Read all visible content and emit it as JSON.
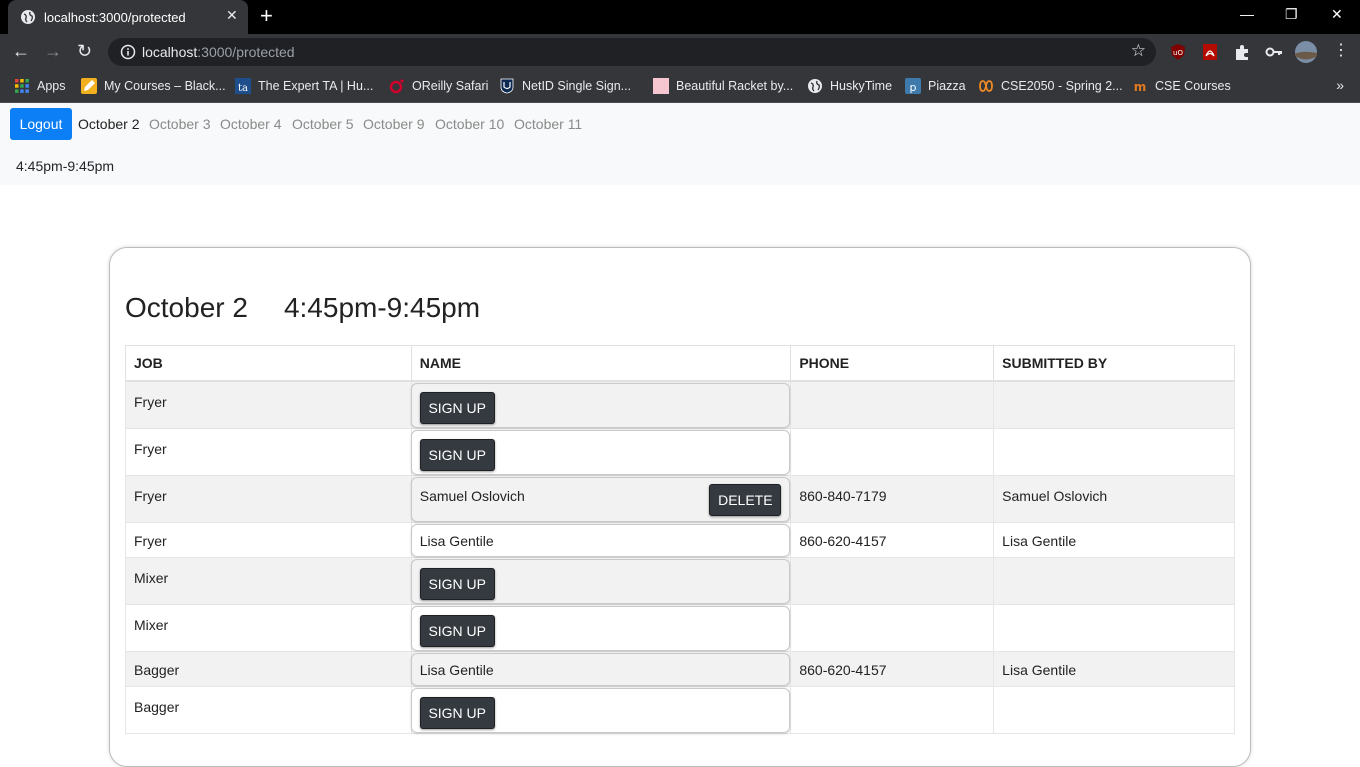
{
  "browser": {
    "tab_title": "localhost:3000/protected",
    "tab_close": "✕",
    "new_tab": "+",
    "url_host": "localhost",
    "url_path": ":3000/protected",
    "bookmarks": [
      {
        "label": "Apps",
        "icon": "apps-grid-icon"
      },
      {
        "label": "My Courses – Black...",
        "icon": "pencil-icon"
      },
      {
        "label": "The Expert TA | Hu...",
        "icon": "expert-ta-icon"
      },
      {
        "label": "OReilly Safari",
        "icon": "oreilly-icon"
      },
      {
        "label": "NetID Single Sign...",
        "icon": "uconn-shield-icon"
      },
      {
        "label": "Beautiful Racket by...",
        "icon": "racket-icon"
      },
      {
        "label": "HuskyTime",
        "icon": "globe-icon"
      },
      {
        "label": "Piazza",
        "icon": "piazza-icon"
      },
      {
        "label": "CSE2050 - Spring 2...",
        "icon": "infinity-icon"
      },
      {
        "label": "CSE Courses",
        "icon": "mooc-icon"
      }
    ],
    "bookmarks_more": "»"
  },
  "navbar": {
    "logout_label": "Logout",
    "dates": [
      "October 2",
      "October 3",
      "October 4",
      "October 5",
      "October 9",
      "October 10",
      "October 11"
    ],
    "active_date": "October 2",
    "shift_time": "4:45pm-9:45pm"
  },
  "card": {
    "date": "October 2",
    "time": "4:45pm-9:45pm",
    "columns": [
      "JOB",
      "NAME",
      "PHONE",
      "SUBMITTED BY"
    ],
    "rows": [
      {
        "job": "Fryer",
        "name": "",
        "phone": "",
        "submitted_by": "",
        "action": "SIGN UP"
      },
      {
        "job": "Fryer",
        "name": "",
        "phone": "",
        "submitted_by": "",
        "action": "SIGN UP"
      },
      {
        "job": "Fryer",
        "name": "Samuel Oslovich",
        "phone": "860-840-7179",
        "submitted_by": "Samuel Oslovich",
        "action": "DELETE"
      },
      {
        "job": "Fryer",
        "name": "Lisa Gentile",
        "phone": "860-620-4157",
        "submitted_by": "Lisa Gentile",
        "action": ""
      },
      {
        "job": "Mixer",
        "name": "",
        "phone": "",
        "submitted_by": "",
        "action": "SIGN UP"
      },
      {
        "job": "Mixer",
        "name": "",
        "phone": "",
        "submitted_by": "",
        "action": "SIGN UP"
      },
      {
        "job": "Bagger",
        "name": "Lisa Gentile",
        "phone": "860-620-4157",
        "submitted_by": "Lisa Gentile",
        "action": ""
      },
      {
        "job": "Bagger",
        "name": "",
        "phone": "",
        "submitted_by": "",
        "action": "SIGN UP"
      }
    ]
  },
  "colors": {
    "primary": "#0d7ff6",
    "dark_button": "#343a40",
    "navbar_bg": "#f8f9fa"
  }
}
